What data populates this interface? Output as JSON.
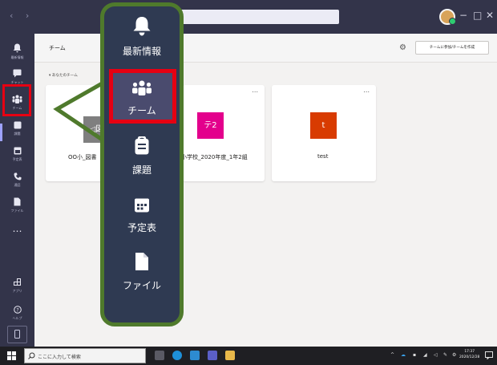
{
  "titlebar": {
    "back_forward": "‹ ›",
    "minimize": "−",
    "maximize": "□",
    "close": "✕"
  },
  "rail": {
    "items": [
      {
        "label": "最新情報",
        "icon": "bell-icon"
      },
      {
        "label": "チャット",
        "icon": "chat-icon"
      },
      {
        "label": "チーム",
        "icon": "teams-icon"
      },
      {
        "label": "課題",
        "icon": "assignments-icon"
      },
      {
        "label": "予定表",
        "icon": "calendar-icon"
      },
      {
        "label": "通話",
        "icon": "phone-icon"
      },
      {
        "label": "ファイル",
        "icon": "file-icon"
      },
      {
        "label": "…",
        "icon": "more-icon"
      },
      {
        "label": "アプリ",
        "icon": "apps-icon"
      },
      {
        "label": "ヘルプ",
        "icon": "help-icon"
      }
    ]
  },
  "header": {
    "title": "チーム",
    "join_button": "チームに参加/チームを作成"
  },
  "section_label": "▾ あなたのチーム",
  "cards": [
    {
      "name": "OO小_図書",
      "tile_text": "◁図",
      "color": "#7f7f7f"
    },
    {
      "name": "小学校_2020年度_1年2組",
      "tile_text": "テ2",
      "color": "#e3008c"
    },
    {
      "name": "test",
      "tile_text": "t",
      "color": "#d83b01"
    }
  ],
  "card_more": "...",
  "overlay": {
    "items": [
      {
        "label": "最新情報",
        "icon": "bell-icon"
      },
      {
        "label": "チーム",
        "icon": "teams-icon"
      },
      {
        "label": "課題",
        "icon": "assignments-icon"
      },
      {
        "label": "予定表",
        "icon": "calendar-icon"
      },
      {
        "label": "ファイル",
        "icon": "file-icon"
      }
    ],
    "highlight_color": "#e60012",
    "frame_color": "#4f7a2c"
  },
  "taskbar": {
    "search_placeholder": "ここに入力して検索",
    "time": "17:37",
    "date": "2020/12/28"
  }
}
